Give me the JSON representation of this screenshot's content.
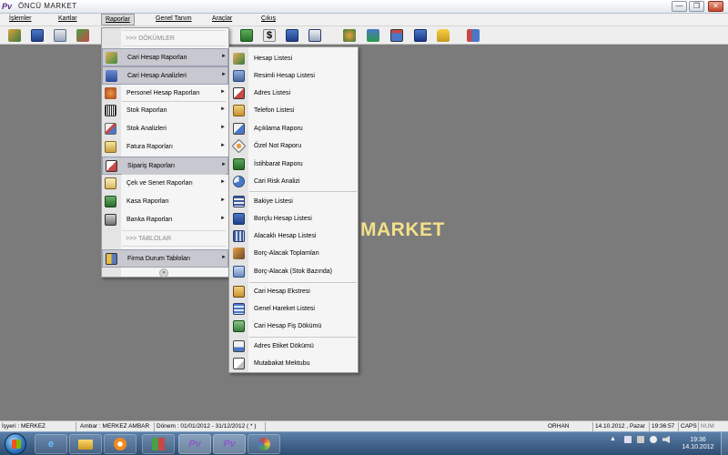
{
  "window": {
    "title": "ÖNCÜ MARKET",
    "app_icon_glyph": "Pv",
    "minimize_glyph": "—",
    "restore_glyph": "❐",
    "close_glyph": "✕"
  },
  "menubar": {
    "items": [
      "İşlemler",
      "Kartlar",
      "Raporlar",
      "Genel Tanım",
      "Araçlar",
      "Çıkış"
    ],
    "active": "Raporlar"
  },
  "toolbar": {
    "icons": [
      "user-card-icon",
      "list-icon",
      "document-icon",
      "transfer-icon",
      "cash-register-icon",
      "dollar-icon",
      "book-icon",
      "list-icon",
      "users-icon",
      "tree-icon",
      "window-icon",
      "calculator-icon",
      "lock-icon",
      "exit-icon"
    ]
  },
  "workspace": {
    "background_text": "MARKET"
  },
  "menu1": {
    "section_dokumler": ">>> DÖKÜMLER",
    "section_tablolar": ">>> TABLOLAR",
    "items": [
      {
        "label": "Cari Hesap Raporları",
        "icon": "person-card-icon",
        "highlighted": true
      },
      {
        "label": "Cari Hesap Analizleri",
        "icon": "analysis-icon",
        "highlighted": true
      },
      {
        "label": "Personel Hesap Raporları",
        "icon": "personnel-icon",
        "highlighted": false
      },
      {
        "label": "Stok Raporları",
        "icon": "barcode-icon",
        "highlighted": false
      },
      {
        "label": "Stok Analizleri",
        "icon": "chart-icon",
        "highlighted": false
      },
      {
        "label": "Fatura Raporları",
        "icon": "invoice-icon",
        "highlighted": false
      },
      {
        "label": "Sipariş Raporları",
        "icon": "order-icon",
        "highlighted": true
      },
      {
        "label": "Çek ve Senet Raporları",
        "icon": "cheque-icon",
        "highlighted": false
      },
      {
        "label": "Kasa Raporları",
        "icon": "cash-icon",
        "highlighted": false
      },
      {
        "label": "Banka Raporları",
        "icon": "bank-icon",
        "highlighted": false
      },
      {
        "label": "Firma Durum Tabloları",
        "icon": "table-icon",
        "highlighted": true
      }
    ],
    "arrow_glyph": "►",
    "more_glyph": "»"
  },
  "menu2": {
    "groups": [
      [
        {
          "label": "Hesap Listesi",
          "icon": "person-list-icon"
        },
        {
          "label": "Resimli Hesap Listesi",
          "icon": "picture-list-icon"
        },
        {
          "label": "Adres Listesi",
          "icon": "address-icon"
        },
        {
          "label": "Telefon Listesi",
          "icon": "phone-icon"
        },
        {
          "label": "Açıklama Raporu",
          "icon": "note-icon"
        },
        {
          "label": "Özel Not Raporu",
          "icon": "special-note-icon"
        },
        {
          "label": "İstihbarat Raporu",
          "icon": "intel-icon"
        },
        {
          "label": "Cari Risk Analizi",
          "icon": "pie-icon"
        }
      ],
      [
        {
          "label": "Bakiye Listesi",
          "icon": "balance-icon"
        },
        {
          "label": "Borçlu Hesap Listesi",
          "icon": "debt-icon"
        },
        {
          "label": "Alacaklı Hesap Listesi",
          "icon": "credit-icon"
        },
        {
          "label": "Borç-Alacak Toplamları",
          "icon": "totals-icon"
        },
        {
          "label": "Borç-Alacak (Stok Bazında)",
          "icon": "stock-based-icon"
        }
      ],
      [
        {
          "label": "Cari Hesap Ekstresi",
          "icon": "statement-icon"
        },
        {
          "label": "Genel Hareket Listesi",
          "icon": "movement-icon"
        },
        {
          "label": "Cari Hesap Fiş Dökümü",
          "icon": "receipt-icon"
        }
      ],
      [
        {
          "label": "Adres Etiket Dökümü",
          "icon": "label-icon"
        },
        {
          "label": "Mutabakat Mektubu",
          "icon": "letter-icon"
        }
      ]
    ]
  },
  "statusbar": {
    "workplace": "İşyeri : MERKEZ",
    "warehouse": "Ambar : MERKEZ AMBAR",
    "period": "Dönem : 01/01/2012 - 31/12/2012 ( * )",
    "user": "ORHAN",
    "date": "14.10.2012 , Pazar",
    "time": "19:36:57",
    "caps": "CAPS",
    "num": "NUM"
  },
  "taskbar": {
    "task_glyph": "Pv",
    "clock_time": "19:36",
    "clock_date": "14.10.2012",
    "tray_arrow": "▲"
  },
  "colors": {
    "workspace_bg": "#7b7b7b",
    "brand_text": "#f4e08a",
    "highlight": "#c8c8d0",
    "taskbar": "#2e4d72"
  }
}
